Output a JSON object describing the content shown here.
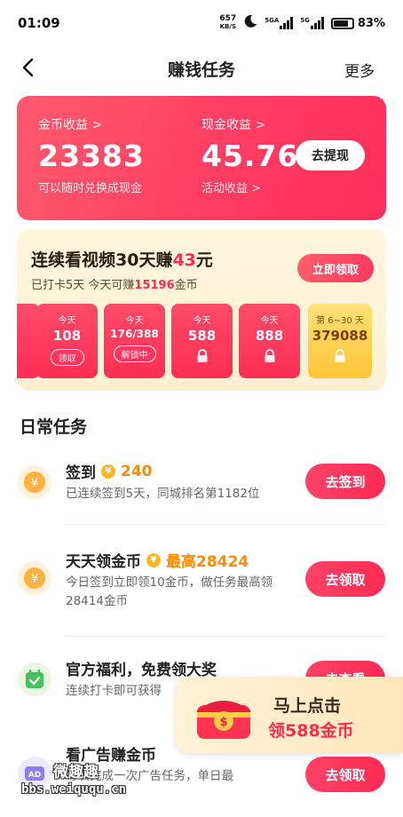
{
  "status_bar": {
    "time": "01:09",
    "net_speed": "657",
    "net_unit": "KB/S",
    "sig1": "5GA",
    "sig2": "5G",
    "battery": "83%"
  },
  "header": {
    "title": "赚钱任务",
    "more": "更多"
  },
  "earnings": {
    "coin_label": "金币收益 >",
    "coin_value": "23383",
    "coin_sub": "可以随时兑换成现金",
    "cash_label": "现金收益 >",
    "cash_value": "45.76",
    "cash_sub": "活动收益 >",
    "withdraw": "去提现"
  },
  "challenge": {
    "title_pre": "连续看视频30天赚",
    "title_amount": "43",
    "title_suffix": "元",
    "sub_pre": "已打卡5天 今天可赚",
    "sub_amount": "15196",
    "sub_suffix": "金币",
    "claim": "立即领取",
    "days": [
      {
        "label": "今天",
        "value": "108",
        "button": "领取"
      },
      {
        "label": "今天",
        "value": "176/388",
        "button": "解锁中"
      },
      {
        "label": "今天",
        "value": "588"
      },
      {
        "label": "今天",
        "value": "888"
      },
      {
        "label": "第 6~30 天",
        "value": "379088"
      }
    ]
  },
  "section_title": "日常任务",
  "tasks": [
    {
      "title": "签到",
      "amount": "240",
      "desc": "已连续签到5天，同城排名第1182位",
      "button": "去签到",
      "icon": "coin-icon"
    },
    {
      "title": "天天领金币",
      "amount": "最高28424",
      "desc": "今日签到立即领10金币，做任务最高领28414金币",
      "button": "去领取",
      "icon": "coin-icon"
    },
    {
      "title": "官方福利，免费领大奖",
      "amount": "",
      "desc": "连续打卡即可获得",
      "button": "去查看",
      "icon": "calendar-check-icon"
    },
    {
      "title": "看广告赚金币",
      "amount": "",
      "desc": "每次完成一次广告任务，单日最",
      "button": "去领取",
      "icon": "ad-icon"
    }
  ],
  "promo": {
    "line1": "马上点击",
    "line2": "领588金币"
  },
  "watermark": {
    "line1": "微趣趣",
    "line2": "bbs.weiququ.cn"
  },
  "colors": {
    "accent": "#ff2d4b",
    "coin": "#ff8a00",
    "gold": "#ffc535"
  }
}
